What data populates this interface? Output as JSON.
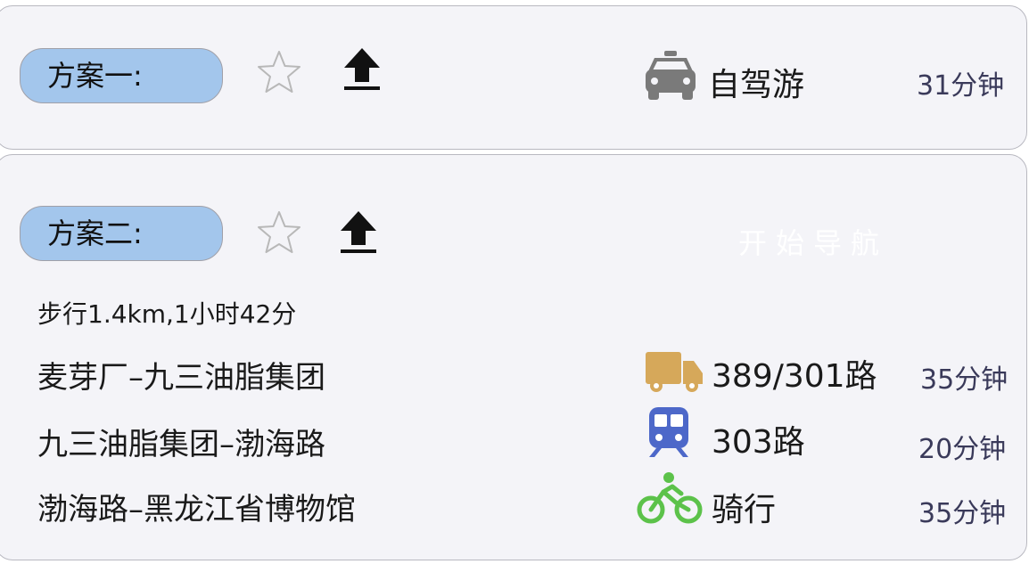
{
  "plan1": {
    "label": "方案一:",
    "mode": "自驾游",
    "duration": "31分钟"
  },
  "plan2": {
    "label": "方案二:",
    "start_nav": "开始导航",
    "summary": "步行1.4km,1小时42分",
    "segments": [
      {
        "route": "麦芽厂–九三油脂集团",
        "mode": "389/301路",
        "duration": "35分钟",
        "icon": "truck-icon",
        "color": "#d6a85a"
      },
      {
        "route": "九三油脂集团–渤海路",
        "mode": "303路",
        "duration": "20分钟",
        "icon": "train-icon",
        "color": "#4d68c9"
      },
      {
        "route": "渤海路–黑龙江省博物馆",
        "mode": "骑行",
        "duration": "35分钟",
        "icon": "bicycle-icon",
        "color": "#5cc24a"
      }
    ]
  },
  "colors": {
    "pill": "#a3c6ec",
    "card": "#f4f4f8",
    "car_icon": "#7a7a7a"
  }
}
